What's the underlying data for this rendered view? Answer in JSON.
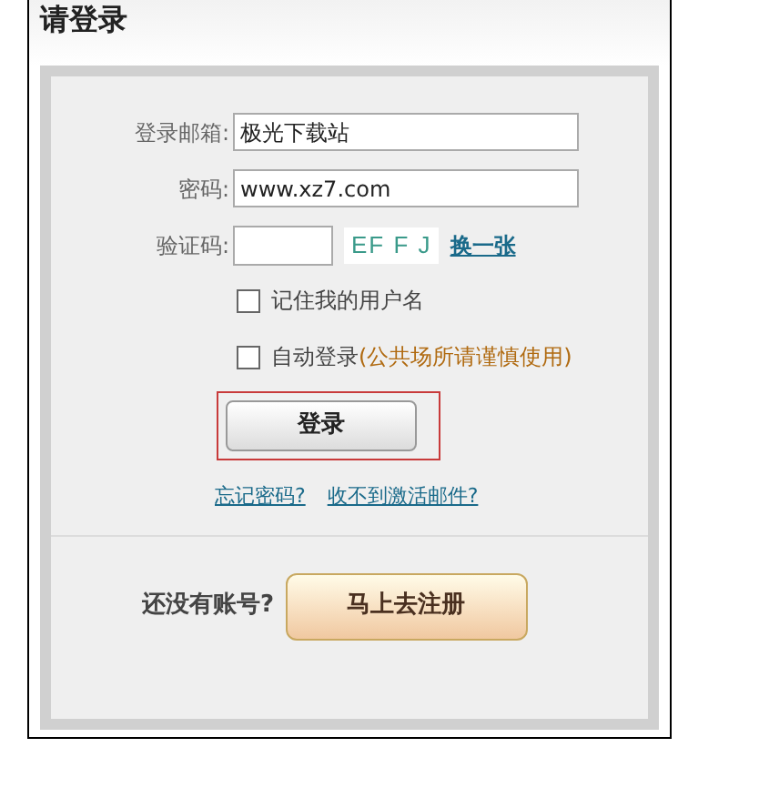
{
  "title": "请登录",
  "fields": [
    {
      "label": "登录邮箱:",
      "value": "极光下载站"
    },
    {
      "label": "密码:",
      "value": "www.xz7.com"
    }
  ],
  "captcha": {
    "label": "验证码:",
    "code": "EF F J",
    "refresh_link": "换一张"
  },
  "checkboxes": [
    {
      "label": "记住我的用户名",
      "checked": false
    },
    {
      "label": "自动登录",
      "note": "(公共场所请谨慎使用)",
      "checked": false
    }
  ],
  "login_button": {
    "label": "登录",
    "highlighted": true
  },
  "links": [
    "忘记密码?",
    "收不到激活邮件?"
  ],
  "register": {
    "prompt": "还没有账号?",
    "button": "马上去注册"
  }
}
